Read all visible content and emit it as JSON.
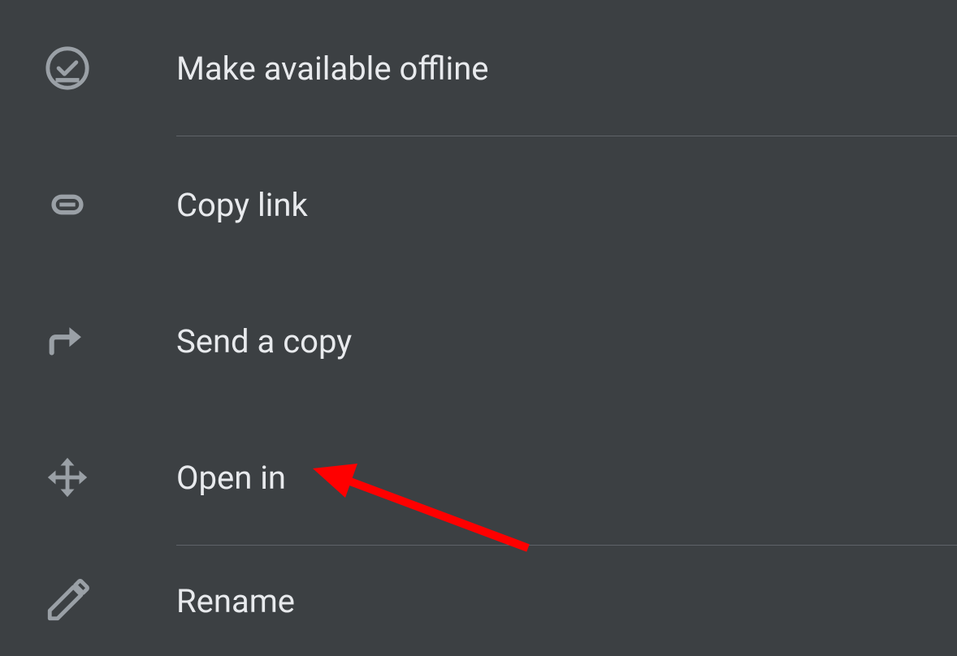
{
  "menu": {
    "items": [
      {
        "label": "Make available offline",
        "icon": "offline-check-icon",
        "has_divider": true
      },
      {
        "label": "Copy link",
        "icon": "link-icon",
        "has_divider": false
      },
      {
        "label": "Send a copy",
        "icon": "share-arrow-icon",
        "has_divider": false
      },
      {
        "label": "Open in",
        "icon": "move-arrows-icon",
        "has_divider": true
      },
      {
        "label": "Rename",
        "icon": "pencil-icon",
        "has_divider": false
      }
    ]
  },
  "annotation": {
    "type": "arrow",
    "color": "#ff0000",
    "target": "Open in"
  }
}
